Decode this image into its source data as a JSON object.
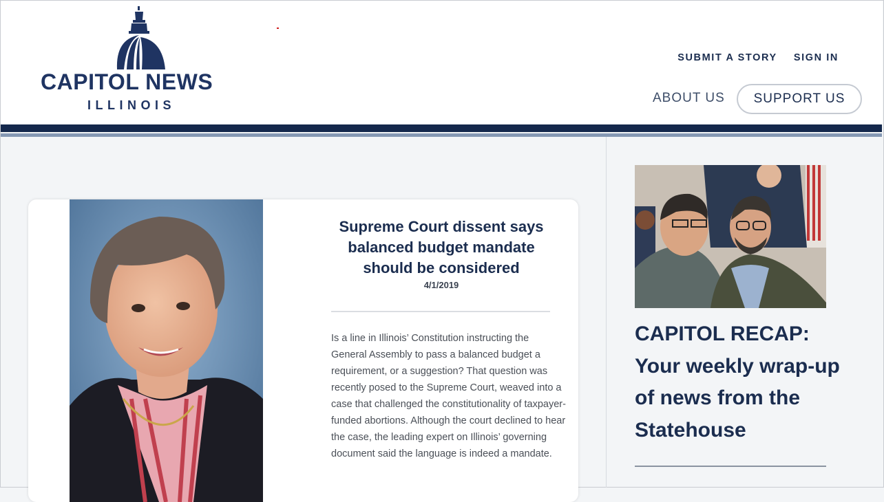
{
  "brand": {
    "name_line1": "CAPITOL NEWS",
    "name_line2": "ILLINOIS",
    "primary_color": "#1f3462",
    "accent_dark": "#14284c",
    "accent_light": "#8598b4"
  },
  "utility_nav": [
    {
      "label": "SUBMIT A STORY"
    },
    {
      "label": "SIGN IN"
    }
  ],
  "main_nav": {
    "about_label": "ABOUT US",
    "support_label": "SUPPORT US"
  },
  "featured_article": {
    "title": "Supreme Court dissent says balanced budget mandate should be considered",
    "date": "4/1/2019",
    "excerpt": "Is a line in Illinois’ Constitution instructing the General Assembly to pass a balanced budget a requirement, or a suggestion? That question was recently posed to the Supreme Court, weaved into a case that challenged the constitutionality of taxpayer-funded abortions. Although the court declined to hear the case, the leading expert on Illinois’ governing document said the language is indeed a mandate.",
    "image_icon": "portrait-photo"
  },
  "sidebar_feature": {
    "title": "CAPITOL RECAP: Your weekly wrap-up of news from the Statehouse",
    "image_icon": "hearing-photo"
  }
}
